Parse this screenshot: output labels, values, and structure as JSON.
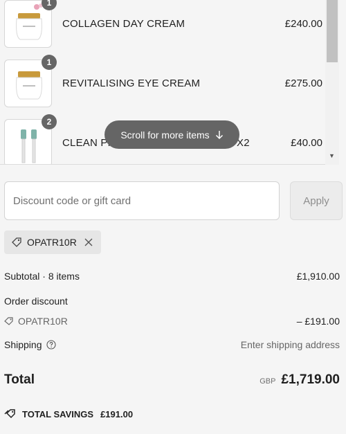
{
  "items": [
    {
      "name": "COLLAGEN DAY CREAM",
      "price": "£240.00",
      "quantity": "1",
      "icon": "cream-jar-icon"
    },
    {
      "name": "REVITALISING EYE CREAM",
      "price": "£275.00",
      "quantity": "1",
      "icon": "cream-jar-icon"
    },
    {
      "name": "CLEAN PR",
      "name_tail": "X2",
      "price": "£40.00",
      "quantity": "2",
      "icon": "toothbrush-heads-icon"
    }
  ],
  "scroll_hint": {
    "label": "Scroll for more items",
    "icon": "arrow-down-icon"
  },
  "discount": {
    "placeholder": "Discount code or gift card",
    "apply_label": "Apply"
  },
  "applied_code": {
    "code": "OPATR10R",
    "icon": "tag-icon",
    "remove_icon": "close-icon"
  },
  "summary": {
    "subtotal_label": "Subtotal · 8 items",
    "subtotal_value": "£1,910.00",
    "order_discount_label": "Order discount",
    "discount_code": "OPATR10R",
    "discount_value": "– £191.00",
    "shipping_label": "Shipping",
    "shipping_value": "Enter shipping address",
    "total_label": "Total",
    "currency": "GBP",
    "total_value": "£1,719.00",
    "savings_label": "TOTAL SAVINGS",
    "savings_value": "£191.00"
  },
  "colors": {
    "badge": "#666666",
    "pill": "#656565",
    "background": "#f5f5f5"
  }
}
